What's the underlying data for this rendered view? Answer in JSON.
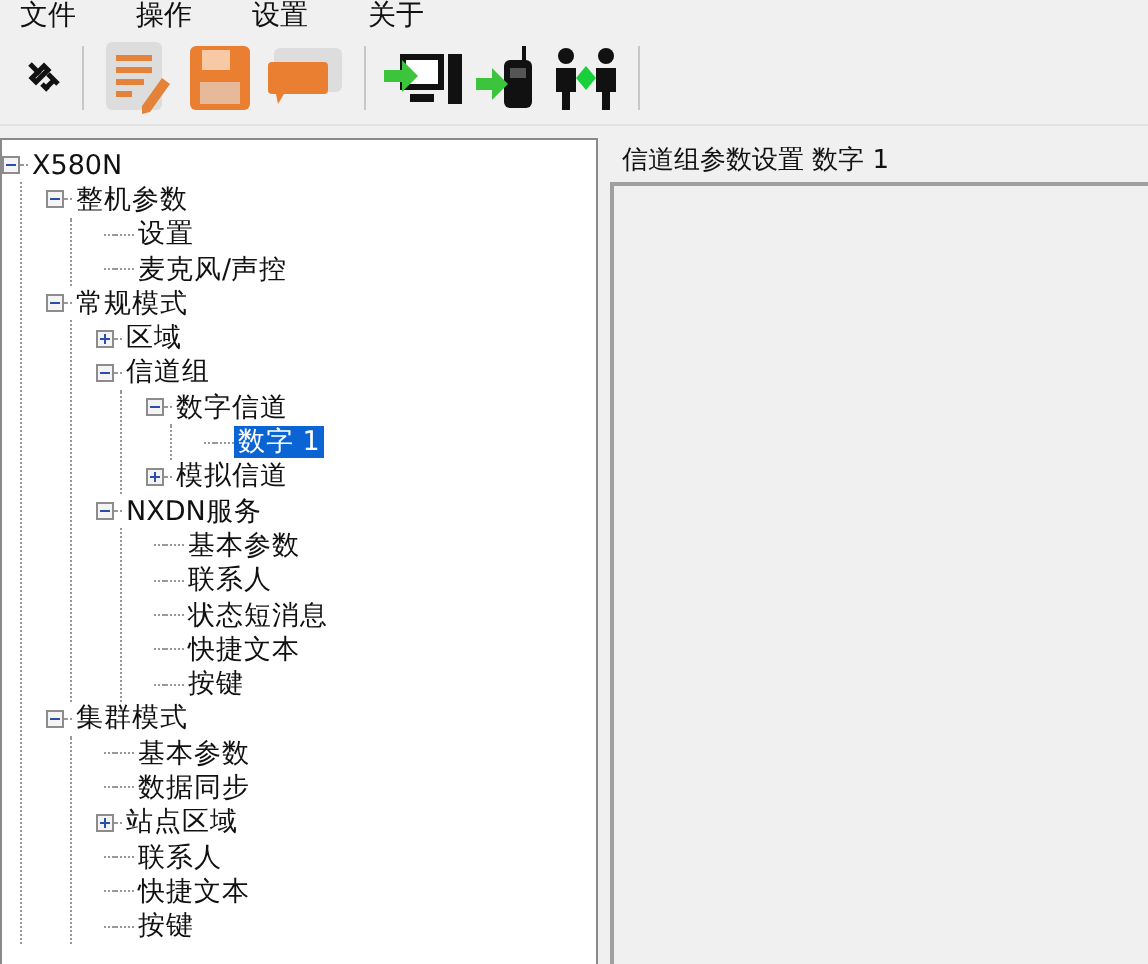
{
  "menu": [
    {
      "label": "文件"
    },
    {
      "label": "操作"
    },
    {
      "label": "设置"
    },
    {
      "label": "关于"
    }
  ],
  "toolbar": [
    {
      "kind": "plug"
    },
    {
      "kind": "separator"
    },
    {
      "kind": "notepad"
    },
    {
      "kind": "floppy"
    },
    {
      "kind": "bubble"
    },
    {
      "kind": "separator"
    },
    {
      "kind": "monitor"
    },
    {
      "kind": "radio"
    },
    {
      "kind": "people"
    },
    {
      "kind": "separator"
    }
  ],
  "tree": [
    {
      "label": "X580N",
      "expanded": true,
      "selected": false,
      "children": [
        {
          "label": "整机参数",
          "expanded": true,
          "selected": false,
          "children": [
            {
              "label": "设置",
              "selected": false
            },
            {
              "label": "麦克风/声控",
              "selected": false
            }
          ]
        },
        {
          "label": "常规模式",
          "expanded": true,
          "selected": false,
          "children": [
            {
              "label": "区域",
              "expanded": false,
              "selected": false
            },
            {
              "label": "信道组",
              "expanded": true,
              "selected": false,
              "children": [
                {
                  "label": "数字信道",
                  "expanded": true,
                  "selected": false,
                  "children": [
                    {
                      "label": "数字 1",
                      "selected": true
                    }
                  ]
                },
                {
                  "label": "模拟信道",
                  "expanded": false,
                  "selected": false
                }
              ]
            },
            {
              "label": "NXDN服务",
              "expanded": true,
              "selected": false,
              "children": [
                {
                  "label": "基本参数",
                  "selected": false
                },
                {
                  "label": "联系人",
                  "selected": false
                },
                {
                  "label": "状态短消息",
                  "selected": false
                },
                {
                  "label": "快捷文本",
                  "selected": false
                },
                {
                  "label": "按键",
                  "selected": false
                }
              ]
            }
          ]
        },
        {
          "label": "集群模式",
          "expanded": true,
          "selected": false,
          "children": [
            {
              "label": "基本参数",
              "selected": false
            },
            {
              "label": "数据同步",
              "selected": false
            },
            {
              "label": "站点区域",
              "expanded": false,
              "selected": false
            },
            {
              "label": "联系人",
              "selected": false
            },
            {
              "label": "快捷文本",
              "selected": false
            },
            {
              "label": "按键",
              "selected": false
            }
          ]
        }
      ]
    }
  ],
  "panel": {
    "title": "信道组参数设置 数字 1"
  }
}
